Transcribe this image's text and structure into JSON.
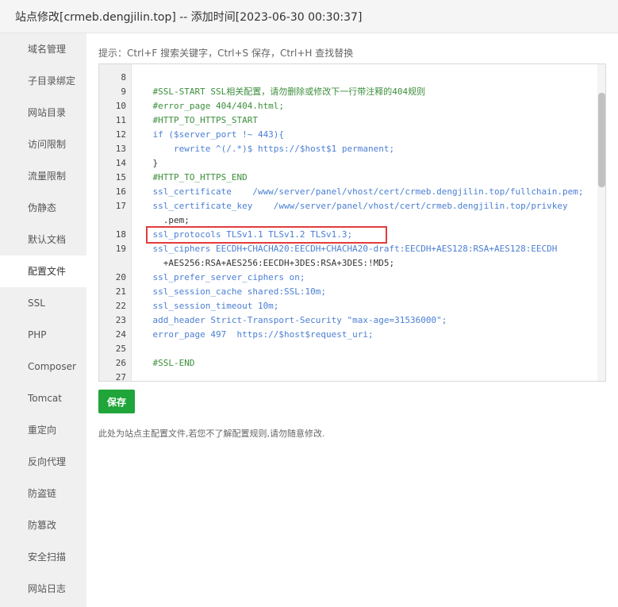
{
  "window": {
    "title": "站点修改[crmeb.dengjilin.top] -- 添加时间[2023-06-30 00:30:37]"
  },
  "sidebar": {
    "items": [
      {
        "label": "域名管理",
        "active": false
      },
      {
        "label": "子目录绑定",
        "active": false
      },
      {
        "label": "网站目录",
        "active": false
      },
      {
        "label": "访问限制",
        "active": false
      },
      {
        "label": "流量限制",
        "active": false
      },
      {
        "label": "伪静态",
        "active": false
      },
      {
        "label": "默认文档",
        "active": false
      },
      {
        "label": "配置文件",
        "active": true
      },
      {
        "label": "SSL",
        "active": false
      },
      {
        "label": "PHP",
        "active": false
      },
      {
        "label": "Composer",
        "active": false
      },
      {
        "label": "Tomcat",
        "active": false
      },
      {
        "label": "重定向",
        "active": false
      },
      {
        "label": "反向代理",
        "active": false
      },
      {
        "label": "防盗链",
        "active": false
      },
      {
        "label": "防篡改",
        "active": false
      },
      {
        "label": "安全扫描",
        "active": false
      },
      {
        "label": "网站日志",
        "active": false
      }
    ]
  },
  "hint": "提示：Ctrl+F 搜索关键字，Ctrl+S 保存，Ctrl+H 查找替换",
  "editor": {
    "lines": [
      {
        "num": "8",
        "text": ""
      },
      {
        "num": "9",
        "text": "    #SSL-START SSL相关配置，请勿删除或修改下一行带注释的404规则"
      },
      {
        "num": "10",
        "text": "    #error_page 404/404.html;"
      },
      {
        "num": "11",
        "text": "    #HTTP_TO_HTTPS_START"
      },
      {
        "num": "12",
        "text": "    if ($server_port !~ 443){"
      },
      {
        "num": "13",
        "text": "        rewrite ^(/.*)$ https://$host$1 permanent;"
      },
      {
        "num": "14",
        "text": "    }"
      },
      {
        "num": "15",
        "text": "    #HTTP_TO_HTTPS_END"
      },
      {
        "num": "16",
        "text": "    ssl_certificate    /www/server/panel/vhost/cert/crmeb.dengjilin.top/fullchain.pem;"
      },
      {
        "num": "17",
        "text": "    ssl_certificate_key    /www/server/panel/vhost/cert/crmeb.dengjilin.top/privkey"
      },
      {
        "num": "",
        "text": "      .pem;"
      },
      {
        "num": "18",
        "text": "    ssl_protocols TLSv1.1 TLSv1.2 TLSv1.3;"
      },
      {
        "num": "19",
        "text": "    ssl_ciphers EECDH+CHACHA20:EECDH+CHACHA20-draft:EECDH+AES128:RSA+AES128:EECDH"
      },
      {
        "num": "",
        "text": "      +AES256:RSA+AES256:EECDH+3DES:RSA+3DES:!MD5;"
      },
      {
        "num": "20",
        "text": "    ssl_prefer_server_ciphers on;"
      },
      {
        "num": "21",
        "text": "    ssl_session_cache shared:SSL:10m;"
      },
      {
        "num": "22",
        "text": "    ssl_session_timeout 10m;"
      },
      {
        "num": "23",
        "text": "    add_header Strict-Transport-Security \"max-age=31536000\";"
      },
      {
        "num": "24",
        "text": "    error_page 497  https://$host$request_uri;"
      },
      {
        "num": "25",
        "text": ""
      },
      {
        "num": "26",
        "text": "    #SSL-END"
      },
      {
        "num": "27",
        "text": ""
      }
    ],
    "highlighted_line": "18",
    "highlight_color": "#e23c3c"
  },
  "save_button": {
    "label": "保存",
    "color": "#20a53a"
  },
  "note": "此处为站点主配置文件,若您不了解配置规则,请勿随意修改."
}
